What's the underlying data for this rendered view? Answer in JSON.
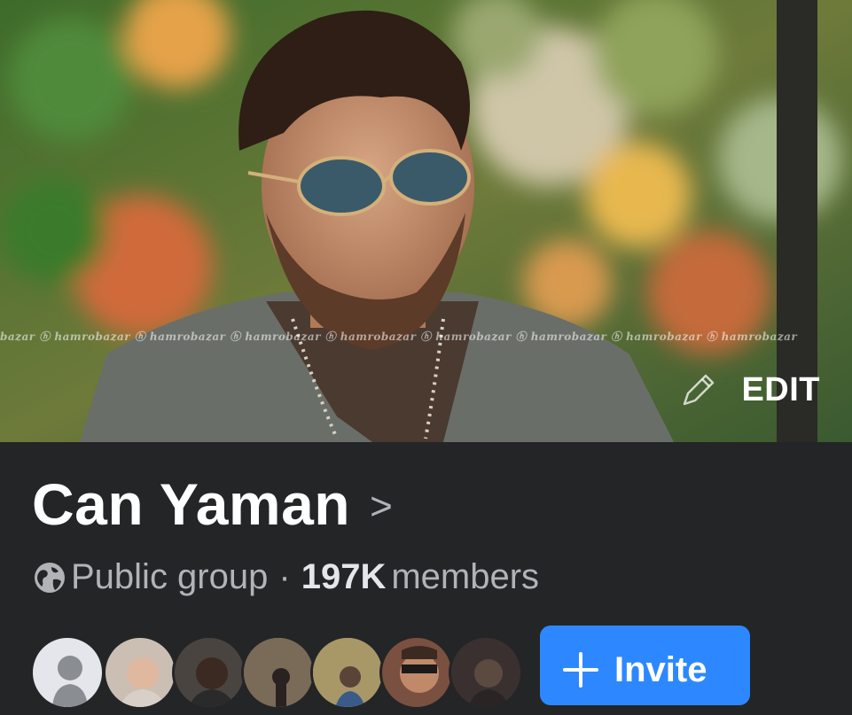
{
  "cover": {
    "watermark_text": "bazar  ⓗ hamrobazar  ⓗ hamrobazar  ⓗ hamrobazar  ⓗ hamrobazar  ⓗ hamrobazar  ⓗ hamrobazar  ⓗ hamrobazar  ⓗ hamrobazar",
    "edit_label": "EDIT",
    "edit_icon": "pencil-icon"
  },
  "group": {
    "name": "Can Yaman",
    "chevron": ">",
    "privacy_icon": "globe-icon",
    "privacy": "Public group",
    "separator": "·",
    "member_count": "197K",
    "members_label": "members"
  },
  "members_preview": {
    "avatars": [
      {
        "name": "default-avatar",
        "color": "#e4e6eb"
      },
      {
        "name": "member-avatar-2",
        "color": "#c9b8a8"
      },
      {
        "name": "member-avatar-3",
        "color": "#5a4a40"
      },
      {
        "name": "member-avatar-4",
        "color": "#8a7a6a"
      },
      {
        "name": "member-avatar-5",
        "color": "#a89868"
      },
      {
        "name": "member-avatar-6",
        "color": "#7a5040"
      },
      {
        "name": "member-avatar-7",
        "color": "#3a3030"
      }
    ]
  },
  "actions": {
    "invite_label": "Invite",
    "invite_icon": "plus-icon",
    "accent": "#2d88ff"
  },
  "colors": {
    "background": "#242526",
    "primary_text": "#ffffff",
    "secondary_text": "#b0b3b8"
  }
}
